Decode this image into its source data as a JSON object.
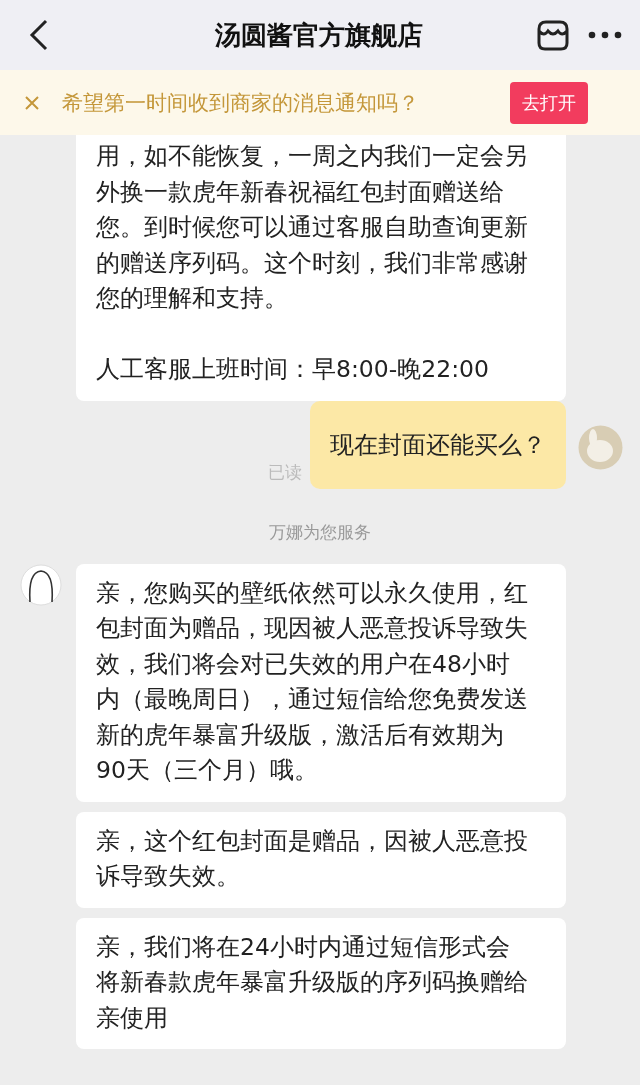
{
  "header": {
    "title": "汤圆酱官方旗舰店"
  },
  "notice": {
    "text": "希望第一时间收到商家的消息通知吗？",
    "button": "去打开"
  },
  "messages": [
    {
      "kind": "incoming",
      "avatar": false,
      "bubbles": [
        {
          "paragraphs": [
            "用，如不能恢复，一周之内我们一定会另外换一款虎年新春祝福红包封面赠送给您。到时候您可以通过客服自助查询更新的赠送序列码。这个时刻，我们非常感谢您的理解和支持。",
            "人工客服上班时间：早8:00-晚22:00"
          ]
        }
      ]
    },
    {
      "kind": "outgoing",
      "texts": [
        "现在封面还能买么？"
      ],
      "read_label": "已读"
    },
    {
      "kind": "system",
      "text": "万娜为您服务"
    },
    {
      "kind": "incoming",
      "avatar": true,
      "bubbles": [
        {
          "paragraphs": [
            "亲，您购买的壁纸依然可以永久使用，红包封面为赠品，现因被人恶意投诉导致失效，我们将会对已失效的用户在48小时内（最晚周日），通过短信给您免费发送新的虎年暴富升级版，激活后有效期为90天（三个月）哦。"
          ]
        },
        {
          "paragraphs": [
            "亲，这个红包封面是赠品，因被人恶意投诉导致失效。"
          ]
        },
        {
          "paragraphs": [
            "亲，我们将在24小时内通过短信形式会将新春款虎年暴富升级版的序列码换赠给亲使用"
          ]
        }
      ]
    }
  ]
}
